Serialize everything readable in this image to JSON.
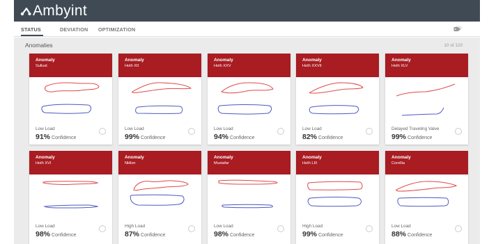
{
  "app": {
    "name": "Ambyint"
  },
  "tabs": [
    {
      "label": "STATUS",
      "active": true
    },
    {
      "label": "DEVIATION",
      "active": false
    },
    {
      "label": "OPTIMIZATION",
      "active": false
    }
  ],
  "section": {
    "title": "Anomalies",
    "count": "10 of 120"
  },
  "colors": {
    "header": "#3f4a54",
    "card_header": "#a81c22",
    "trace_current": "#e04848",
    "trace_reference": "#4a58c0"
  },
  "cards": [
    {
      "kind": "Anomaly",
      "location": "Sullust",
      "label": "Low Load",
      "pct": "91%",
      "unit": "Confidence"
    },
    {
      "kind": "Anomaly",
      "location": "Hoth XII",
      "label": "Low Load",
      "pct": "99%",
      "unit": "Confidence"
    },
    {
      "kind": "Anomaly",
      "location": "Hoth XXV",
      "label": "Low Load",
      "pct": "94%",
      "unit": "Confidence"
    },
    {
      "kind": "Anomaly",
      "location": "Hoth XXVII",
      "label": "Low Load",
      "pct": "82%",
      "unit": "Confidence"
    },
    {
      "kind": "Anomaly",
      "location": "Hoth XLV",
      "label": "Delayed Traveling Valve",
      "pct": "99%",
      "unit": "Confidence"
    },
    {
      "kind": "Anomaly",
      "location": "Hoth XVI",
      "label": "Low Load",
      "pct": "98%",
      "unit": "Confidence"
    },
    {
      "kind": "Anomaly",
      "location": "Nkllon",
      "label": "High Load",
      "pct": "87%",
      "unit": "Confidence"
    },
    {
      "kind": "Anomaly",
      "location": "Mustafar",
      "label": "Low Load",
      "pct": "98%",
      "unit": "Confidence"
    },
    {
      "kind": "Anomaly",
      "location": "Hoth LIII",
      "label": "High Load",
      "pct": "99%",
      "unit": "Confidence"
    },
    {
      "kind": "Anomaly",
      "location": "Corellia",
      "label": "Low Load",
      "pct": "88%",
      "unit": "Confidence"
    }
  ]
}
